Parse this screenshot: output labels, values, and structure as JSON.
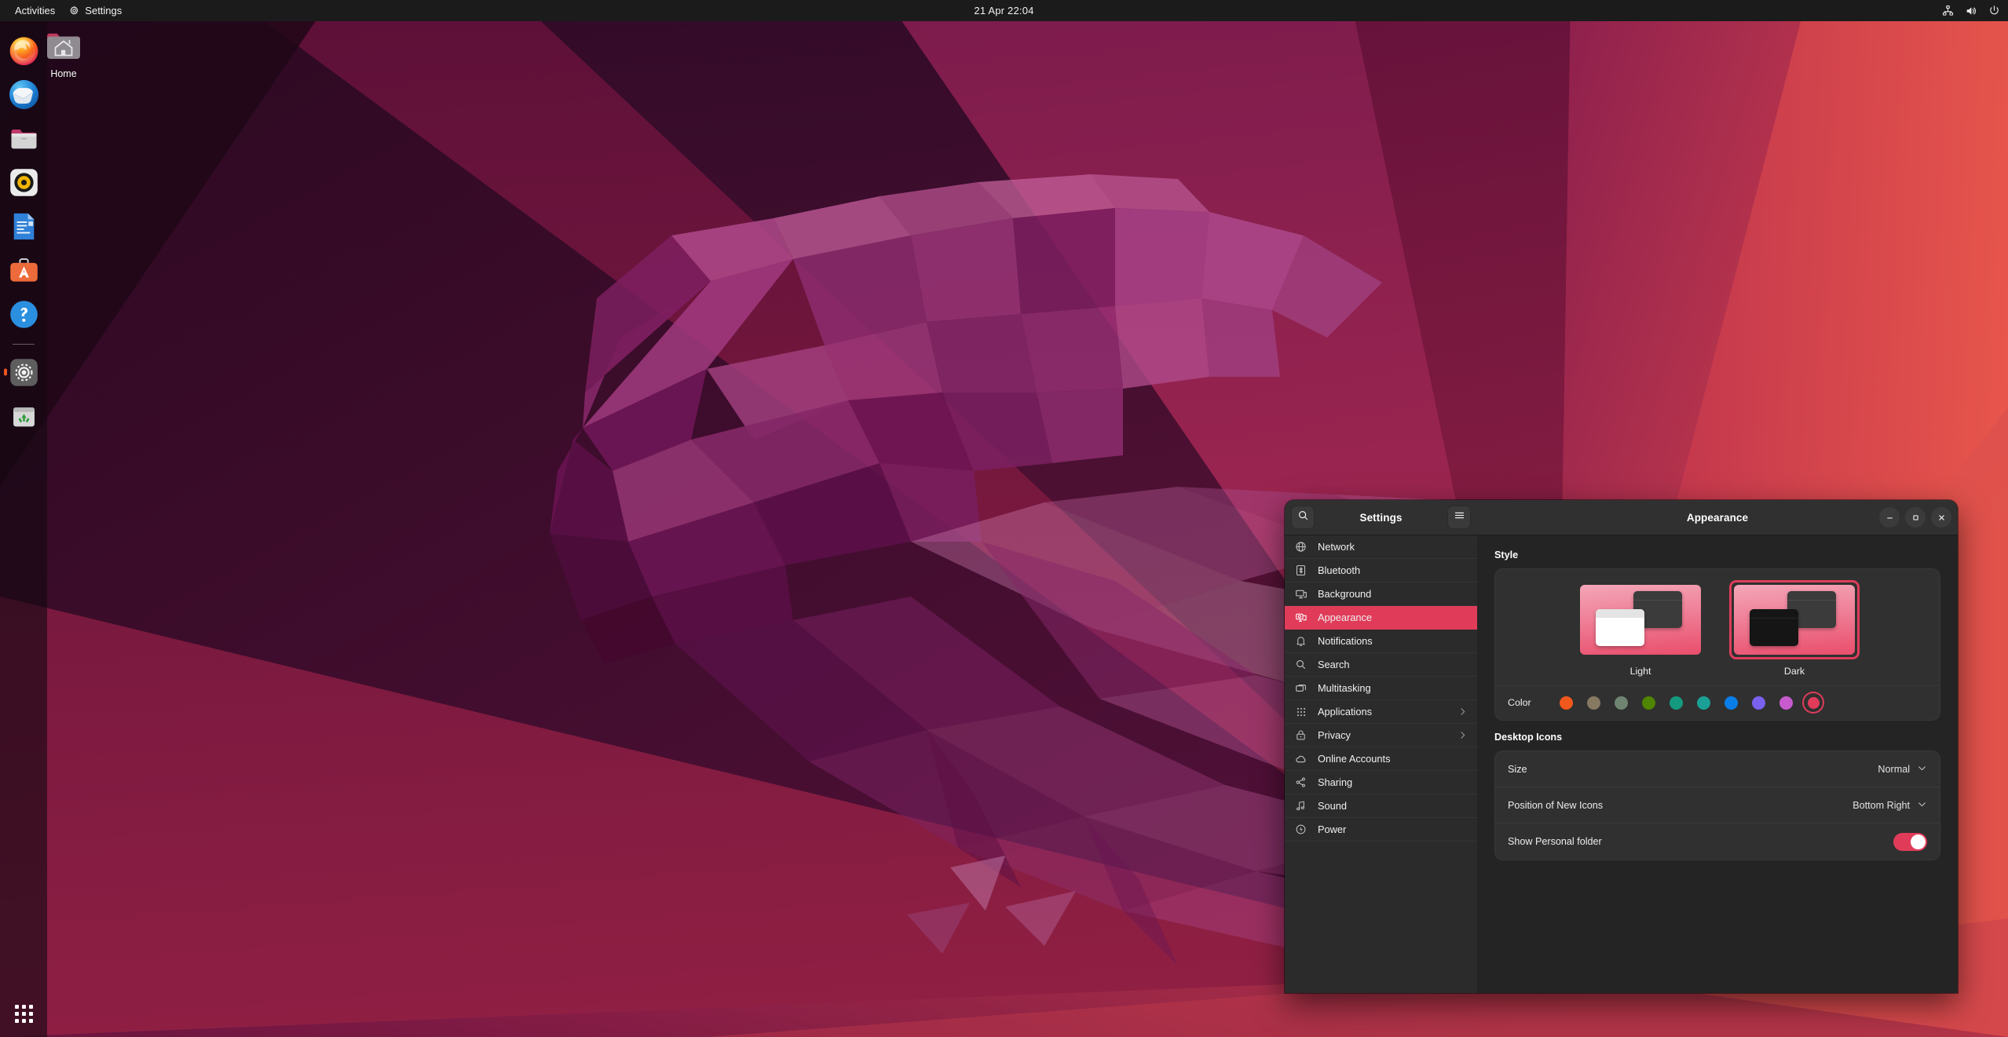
{
  "topbar": {
    "activities_label": "Activities",
    "app_menu_label": "Settings",
    "app_menu_icon": "gear-icon",
    "clock": "21 Apr  22:04",
    "tray": [
      {
        "name": "network-wired-icon"
      },
      {
        "name": "volume-icon"
      },
      {
        "name": "power-icon"
      }
    ]
  },
  "dock": {
    "items": [
      {
        "name": "firefox",
        "label": "Firefox",
        "running": false
      },
      {
        "name": "thunderbird",
        "label": "Thunderbird",
        "running": false
      },
      {
        "name": "files",
        "label": "Files",
        "running": false
      },
      {
        "name": "rhythmbox",
        "label": "Rhythmbox",
        "running": false
      },
      {
        "name": "libreoffice-writer",
        "label": "LibreOffice Writer",
        "running": false
      },
      {
        "name": "ubuntu-software",
        "label": "Ubuntu Software",
        "running": false
      },
      {
        "name": "help",
        "label": "Help",
        "running": false
      },
      {
        "name": "settings",
        "label": "Settings",
        "running": true
      },
      {
        "name": "trash",
        "label": "Trash",
        "running": false
      }
    ],
    "show_apps_label": "Show Applications"
  },
  "desktop": {
    "icons": [
      {
        "name": "home-folder",
        "label": "Home"
      }
    ]
  },
  "window": {
    "sidebar_title": "Settings",
    "title": "Appearance",
    "search_icon": "search-icon",
    "menu_icon": "hamburger-menu-icon",
    "controls": {
      "minimize": "–",
      "maximize": "□",
      "close": "✕"
    },
    "nav": [
      {
        "label": "Network",
        "icon": "globe-icon",
        "active": false,
        "chevron": false
      },
      {
        "label": "Bluetooth",
        "icon": "bluetooth-icon",
        "active": false,
        "chevron": false
      },
      {
        "label": "Background",
        "icon": "monitor-icon",
        "active": false,
        "chevron": false
      },
      {
        "label": "Appearance",
        "icon": "appearance-icon",
        "active": true,
        "chevron": false
      },
      {
        "label": "Notifications",
        "icon": "bell-icon",
        "active": false,
        "chevron": false
      },
      {
        "label": "Search",
        "icon": "search-icon",
        "active": false,
        "chevron": false
      },
      {
        "label": "Multitasking",
        "icon": "windows-icon",
        "active": false,
        "chevron": false
      },
      {
        "label": "Applications",
        "icon": "grid-icon",
        "active": false,
        "chevron": true
      },
      {
        "label": "Privacy",
        "icon": "lock-icon",
        "active": false,
        "chevron": true
      },
      {
        "label": "Online Accounts",
        "icon": "cloud-icon",
        "active": false,
        "chevron": false
      },
      {
        "label": "Sharing",
        "icon": "share-icon",
        "active": false,
        "chevron": false
      },
      {
        "label": "Sound",
        "icon": "music-note-icon",
        "active": false,
        "chevron": false
      },
      {
        "label": "Power",
        "icon": "power-bolt-icon",
        "active": false,
        "chevron": false
      }
    ],
    "style_section": {
      "heading": "Style",
      "options": [
        {
          "label": "Light",
          "selected": false
        },
        {
          "label": "Dark",
          "selected": true
        }
      ],
      "color_label": "Color",
      "colors": [
        {
          "name": "orange",
          "hex": "#f2581c",
          "selected": false
        },
        {
          "name": "bark",
          "hex": "#867a62",
          "selected": false
        },
        {
          "name": "sage",
          "hex": "#6f8572",
          "selected": false
        },
        {
          "name": "olive",
          "hex": "#4f8500",
          "selected": false
        },
        {
          "name": "viridian",
          "hex": "#139a7f",
          "selected": false
        },
        {
          "name": "prussian-green",
          "hex": "#1ba097",
          "selected": false
        },
        {
          "name": "blue",
          "hex": "#0a7ee8",
          "selected": false
        },
        {
          "name": "purple",
          "hex": "#7a61ef",
          "selected": false
        },
        {
          "name": "magenta",
          "hex": "#c75bcd",
          "selected": false
        },
        {
          "name": "red",
          "hex": "#e03c5a",
          "selected": true
        }
      ]
    },
    "desktop_icons_section": {
      "heading": "Desktop Icons",
      "rows": [
        {
          "label": "Size",
          "value": "Normal",
          "control": "dropdown"
        },
        {
          "label": "Position of New Icons",
          "value": "Bottom Right",
          "control": "dropdown"
        },
        {
          "label": "Show Personal folder",
          "value": "on",
          "control": "toggle"
        }
      ]
    }
  },
  "theme": {
    "accent": "#e03c5a",
    "window_bg": "#242424",
    "sidebar_bg": "#2b2b2b",
    "header_bg": "#303030",
    "topbar_bg": "#1b1b1b",
    "ubuntu_orange": "#e95420"
  }
}
